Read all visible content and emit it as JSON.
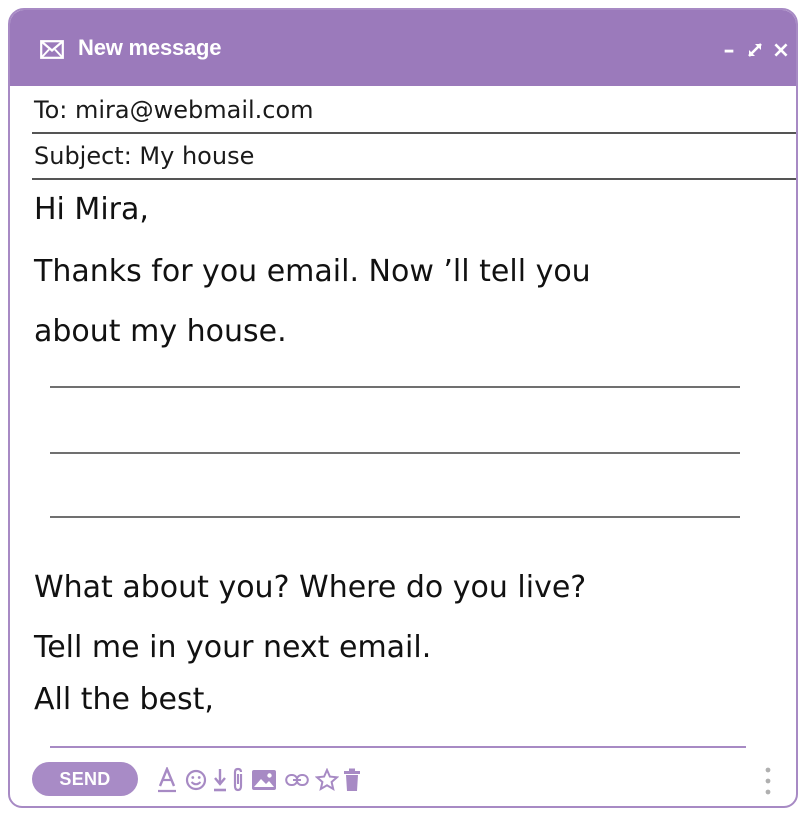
{
  "window": {
    "title": "New message",
    "controls": {
      "minimize": "–",
      "expand": "⤢",
      "close": "×"
    }
  },
  "header": {
    "to": "To: mira@webmail.com",
    "subject": "Subject: My house"
  },
  "body": {
    "lines": [
      "Hi Mira,",
      "Thanks for you email. Now ’ll tell you",
      "about my house.",
      "What about you? Where do you live?",
      "Tell me in your next email.",
      "All the best,"
    ]
  },
  "toolbar": {
    "send_label": "SEND",
    "tools": [
      "text-format-icon",
      "emoji-icon",
      "download-icon",
      "attach-icon",
      "image-icon",
      "link-icon",
      "star-icon",
      "trash-icon"
    ],
    "more": "more-options-icon"
  },
  "colors": {
    "accent": "#9b7abb",
    "send": "#a88bc6",
    "icon": "#a78ac4"
  }
}
